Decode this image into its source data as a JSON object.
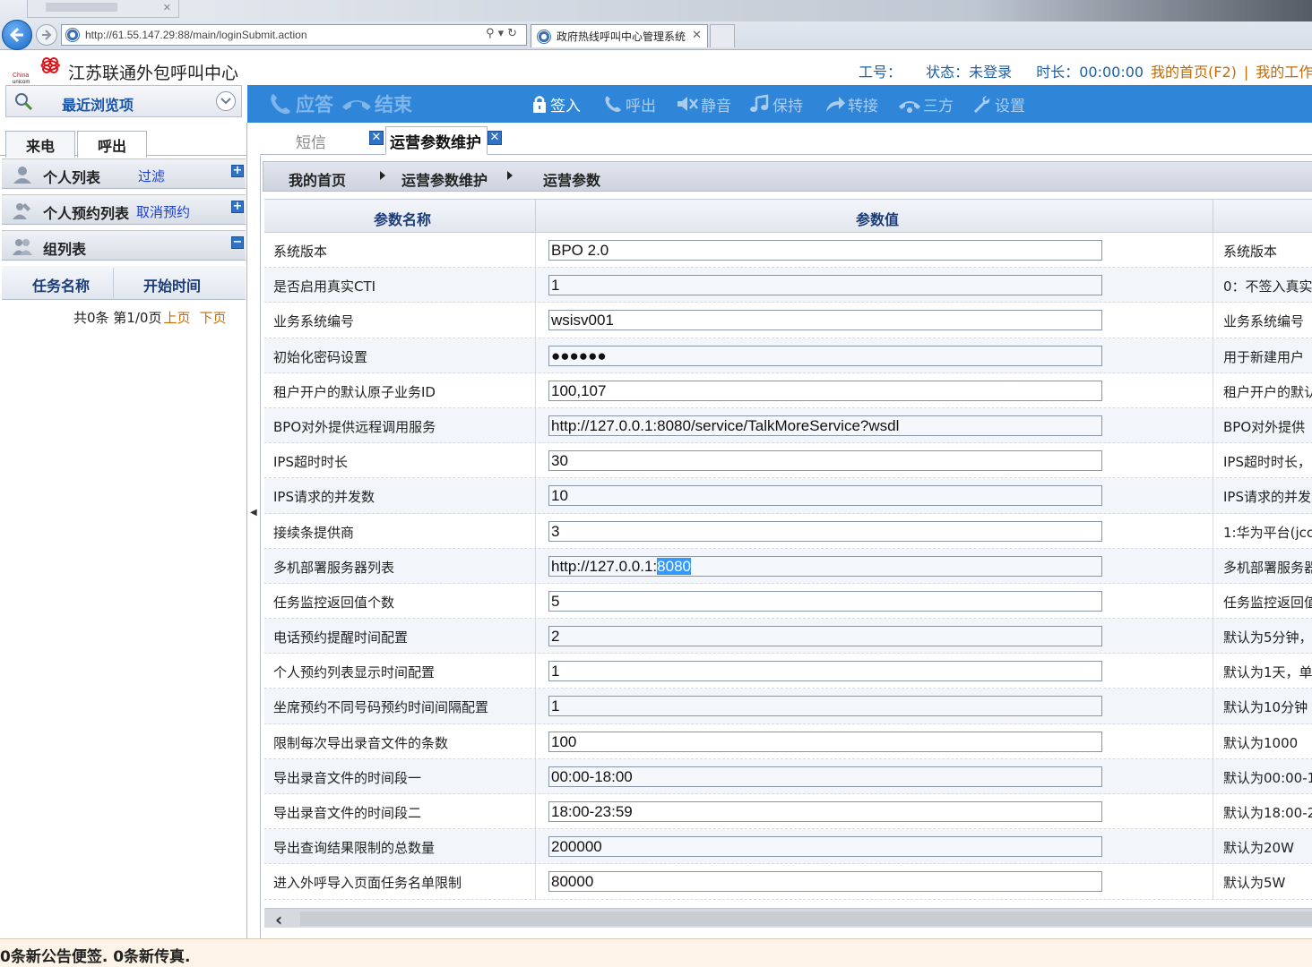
{
  "browser": {
    "url": "http://61.55.147.29:88/main/loginSubmit.action",
    "tab_title": "政府热线呼叫中心管理系统",
    "tab_close": "✕"
  },
  "header": {
    "logo_small_text": "China unicom中国联通",
    "title": "江苏联通外包呼叫中心",
    "job_no": "工号：",
    "status": "状态：未登录",
    "duration": "时长：00:00:00",
    "home_link": "我的首页(F2)",
    "separator": "|",
    "work_link": "我的工作"
  },
  "recent": {
    "label": "最近浏览项"
  },
  "toolbar": {
    "answer": "应答",
    "hangup": "结束",
    "signin": "签入",
    "call_out": "呼出",
    "mute": "静音",
    "hold": "保持",
    "transfer": "转接",
    "three_way": "三方",
    "settings": "设置"
  },
  "left_panel": {
    "tabs": [
      "来电",
      "呼出"
    ],
    "personal_list": "个人列表",
    "filter": "过滤",
    "reservation_list": "个人预约列表",
    "cancel_reservation": "取消预约",
    "group_list": "组列表",
    "col_task": "任务名称",
    "col_start": "开始时间",
    "pager_text": "共0条 第1/0页",
    "prev": "上页",
    "next": "下页"
  },
  "content_tabs": {
    "sms": "短信",
    "ops": "运营参数维护",
    "close": "✕"
  },
  "breadcrumb": [
    "我的首页",
    "运营参数维护",
    "运营参数"
  ],
  "grid": {
    "col_name": "参数名称",
    "col_value": "参数值",
    "rows": [
      {
        "name": "系统版本",
        "value": "BPO 2.0",
        "desc": "系统版本"
      },
      {
        "name": "是否启用真实CTI",
        "value": "1",
        "desc": "0：不签入真实"
      },
      {
        "name": "业务系统编号",
        "value": "wsisv001",
        "desc": "业务系统编号"
      },
      {
        "name": "初始化密码设置",
        "value": "●●●●●●",
        "desc": "用于新建用户"
      },
      {
        "name": "租户开户的默认原子业务ID",
        "value": "100,107",
        "desc": "租户开户的默认"
      },
      {
        "name": "BPO对外提供远程调用服务",
        "value": "http://127.0.0.1:8080/service/TalkMoreService?wsdl",
        "desc": "BPO对外提供"
      },
      {
        "name": "IPS超时时长",
        "value": "30",
        "desc": "IPS超时时长，"
      },
      {
        "name": "IPS请求的并发数",
        "value": "10",
        "desc": "IPS请求的并发"
      },
      {
        "name": "接续条提供商",
        "value": "3",
        "desc": "1:华为平台(jcc"
      },
      {
        "name": "多机部署服务器列表",
        "value": "http://127.0.0.1:",
        "value_selected": "8080",
        "desc": "多机部署服务器"
      },
      {
        "name": "任务监控返回值个数",
        "value": "5",
        "desc": "任务监控返回值"
      },
      {
        "name": "电话预约提醒时间配置",
        "value": "2",
        "desc": "默认为5分钟，"
      },
      {
        "name": "个人预约列表显示时间配置",
        "value": "1",
        "desc": "默认为1天，单"
      },
      {
        "name": "坐席预约不同号码预约时间间隔配置",
        "value": "1",
        "desc": "默认为10分钟"
      },
      {
        "name": "限制每次导出录音文件的条数",
        "value": "100",
        "desc": "默认为1000"
      },
      {
        "name": "导出录音文件的时间段一",
        "value": "00:00-18:00",
        "desc": "默认为00:00-1"
      },
      {
        "name": "导出录音文件的时间段二",
        "value": "18:00-23:59",
        "desc": "默认为18:00-2"
      },
      {
        "name": "导出查询结果限制的总数量",
        "value": "200000",
        "desc": "默认为20W"
      },
      {
        "name": "进入外呼导入页面任务名单限制",
        "value": "80000",
        "desc": "默认为5W"
      }
    ]
  },
  "statusbar": {
    "text": "0条新公告便签. 0条新传真."
  },
  "colors": {
    "toolbar_blue": "#2f86d8",
    "link_orange": "#c56a00",
    "header_blue": "#1c5fa8",
    "status_bg": "#fdf3e6"
  }
}
